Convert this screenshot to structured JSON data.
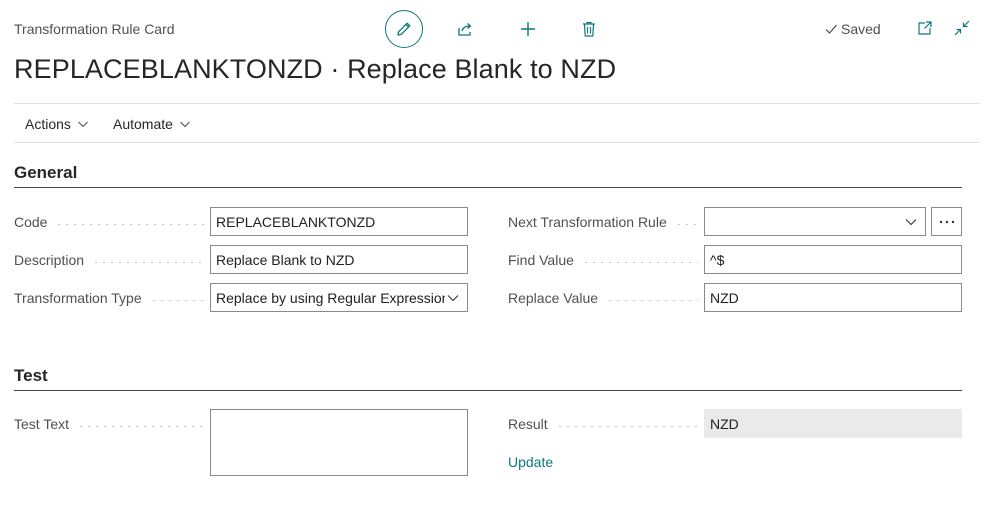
{
  "header": {
    "caption": "Transformation Rule Card",
    "title": "REPLACEBLANKTONZD · Replace Blank to NZD",
    "status": "Saved"
  },
  "toolbar": {
    "icons": [
      "edit-pencil",
      "share",
      "new-plus",
      "delete-trash",
      "open-in-new-window",
      "collapse"
    ]
  },
  "action_menu": {
    "actions_label": "Actions",
    "automate_label": "Automate"
  },
  "sections": {
    "general": {
      "title": "General",
      "fields": {
        "code": {
          "label": "Code",
          "value": "REPLACEBLANKTONZD"
        },
        "description": {
          "label": "Description",
          "value": "Replace Blank to NZD"
        },
        "transformation_type": {
          "label": "Transformation Type",
          "value": "Replace by using Regular Expressions"
        },
        "next_rule": {
          "label": "Next Transformation Rule",
          "value": ""
        },
        "find_value": {
          "label": "Find Value",
          "value": "^$"
        },
        "replace_value": {
          "label": "Replace Value",
          "value": "NZD"
        }
      }
    },
    "test": {
      "title": "Test",
      "fields": {
        "test_text": {
          "label": "Test Text",
          "value": ""
        },
        "result": {
          "label": "Result",
          "value": "NZD"
        }
      },
      "update_label": "Update"
    }
  },
  "colors": {
    "accent": "#0b7a78",
    "label_text": "#505050",
    "readonly_bg": "#eaeaea"
  }
}
